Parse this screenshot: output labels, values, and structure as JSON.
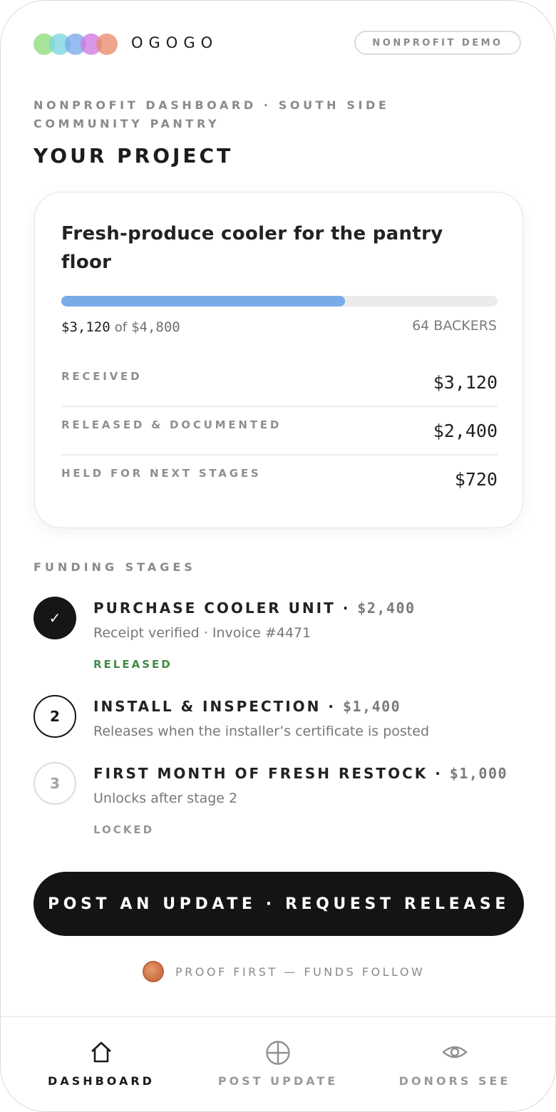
{
  "header": {
    "brand": "OGOGO",
    "demo_badge": "NONPROFIT DEMO",
    "logo_colors": [
      "#8fdc7a",
      "#7ad6e0",
      "#7aa9ea",
      "#cf7ae0",
      "#ea8a6a"
    ]
  },
  "breadcrumb": "NONPROFIT DASHBOARD · SOUTH SIDE COMMUNITY PANTRY",
  "page_title": "YOUR PROJECT",
  "project": {
    "title": "Fresh-produce cooler for the pantry floor",
    "raised": "$3,120",
    "of_label": "of",
    "goal": "$4,800",
    "progress_fraction": 0.65,
    "backers": "64 BACKERS",
    "ledger": [
      {
        "label": "RECEIVED",
        "value": "$3,120"
      },
      {
        "label": "RELEASED & DOCUMENTED",
        "value": "$2,400"
      },
      {
        "label": "HELD FOR NEXT STAGES",
        "value": "$720"
      }
    ]
  },
  "stages_label": "FUNDING STAGES",
  "stages": [
    {
      "marker": "✓",
      "title": "PURCHASE COOLER UNIT",
      "sep": " · ",
      "amount": "$2,400",
      "desc": "Receipt verified · Invoice #4471",
      "status": "RELEASED"
    },
    {
      "marker": "2",
      "title": "INSTALL & INSPECTION",
      "sep": " · ",
      "amount": "$1,400",
      "desc": "Releases when the installer’s certificate is posted",
      "status": ""
    },
    {
      "marker": "3",
      "title": "FIRST MONTH OF FRESH RESTOCK",
      "sep": " · ",
      "amount": "$1,000",
      "desc": "Unlocks after stage 2",
      "status": "LOCKED"
    }
  ],
  "cta_label": "POST AN UPDATE · REQUEST RELEASE",
  "footer_note": "PROOF FIRST — FUNDS FOLLOW",
  "nav": [
    {
      "label": "DASHBOARD",
      "icon": "home-icon",
      "active": true
    },
    {
      "label": "POST UPDATE",
      "icon": "plus-circle-icon",
      "active": false
    },
    {
      "label": "DONORS SEE",
      "icon": "eye-icon",
      "active": false
    }
  ],
  "colors": {
    "progress": "#7aaae8",
    "released": "#3f8b45",
    "cta_bg": "#141414"
  }
}
